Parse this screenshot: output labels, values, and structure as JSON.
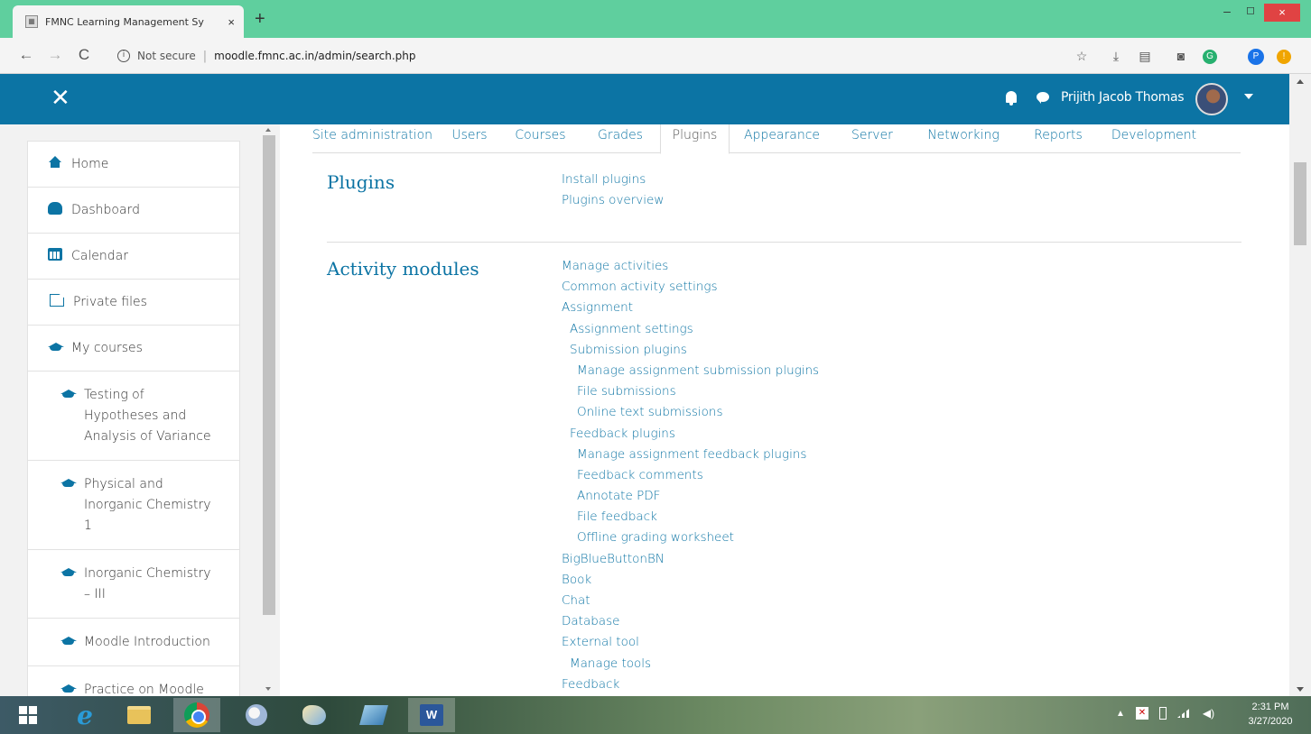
{
  "browser": {
    "tab_title": "FMNC Learning Management Sy",
    "tab_close": "×",
    "new_tab": "+",
    "back": "←",
    "forward": "→",
    "reload": "C",
    "security_label": "Not secure",
    "address_separator": "|",
    "url": "moodle.fmnc.ac.in/admin/search.php",
    "window_minimize": "–",
    "window_maximize": "◻",
    "window_close": "×",
    "bookmark_icon": "☆",
    "download_icon": "⤓",
    "extension_p": "P",
    "extension_g": "G",
    "extension_o": "!"
  },
  "navbar": {
    "close_symbol": "✕",
    "username": "Prijith Jacob Thomas",
    "color": "#0c74a4"
  },
  "drawer": {
    "items": [
      {
        "label": "Home",
        "icon": "home-icon"
      },
      {
        "label": "Dashboard",
        "icon": "dashboard-icon"
      },
      {
        "label": "Calendar",
        "icon": "calendar-icon"
      },
      {
        "label": "Private files",
        "icon": "file-icon"
      },
      {
        "label": "My courses",
        "icon": "graduation-cap-icon"
      }
    ],
    "courses": [
      {
        "label": "Testing of Hypotheses and Analysis of Variance"
      },
      {
        "label": "Physical and Inorganic Chemistry 1"
      },
      {
        "label": "Inorganic Chemistry – III"
      },
      {
        "label": "Moodle Introduction"
      },
      {
        "label": "Practice on Moodle"
      }
    ]
  },
  "admin_tabs": [
    {
      "label": "Site administration",
      "active": false
    },
    {
      "label": "Users",
      "active": false
    },
    {
      "label": "Courses",
      "active": false
    },
    {
      "label": "Grades",
      "active": false
    },
    {
      "label": "Plugins",
      "active": true
    },
    {
      "label": "Appearance",
      "active": false
    },
    {
      "label": "Server",
      "active": false
    },
    {
      "label": "Networking",
      "active": false
    },
    {
      "label": "Reports",
      "active": false
    },
    {
      "label": "Development",
      "active": false
    }
  ],
  "sections": {
    "plugins": {
      "title": "Plugins",
      "links": [
        {
          "label": "Install plugins",
          "level": 1
        },
        {
          "label": "Plugins overview",
          "level": 1
        }
      ]
    },
    "activity": {
      "title": "Activity modules",
      "links": [
        {
          "label": "Manage activities",
          "level": 1
        },
        {
          "label": "Common activity settings",
          "level": 1
        },
        {
          "label": "Assignment",
          "level": 1
        },
        {
          "label": "Assignment settings",
          "level": 2
        },
        {
          "label": "Submission plugins",
          "level": 2
        },
        {
          "label": "Manage assignment submission plugins",
          "level": 3
        },
        {
          "label": "File submissions",
          "level": 3
        },
        {
          "label": "Online text submissions",
          "level": 3
        },
        {
          "label": "Feedback plugins",
          "level": 2
        },
        {
          "label": "Manage assignment feedback plugins",
          "level": 3
        },
        {
          "label": "Feedback comments",
          "level": 3
        },
        {
          "label": "Annotate PDF",
          "level": 3
        },
        {
          "label": "File feedback",
          "level": 3
        },
        {
          "label": "Offline grading worksheet",
          "level": 3
        },
        {
          "label": "BigBlueButtonBN",
          "level": 1
        },
        {
          "label": "Book",
          "level": 1
        },
        {
          "label": "Chat",
          "level": 1
        },
        {
          "label": "Database",
          "level": 1
        },
        {
          "label": "External tool",
          "level": 1
        },
        {
          "label": "Manage tools",
          "level": 2
        },
        {
          "label": "Feedback",
          "level": 1
        }
      ]
    }
  },
  "taskbar": {
    "word_label": "W",
    "ie_label": "e",
    "tray_flag": "✕",
    "clock_time": "2:31 PM",
    "clock_date": "3/27/2020"
  }
}
